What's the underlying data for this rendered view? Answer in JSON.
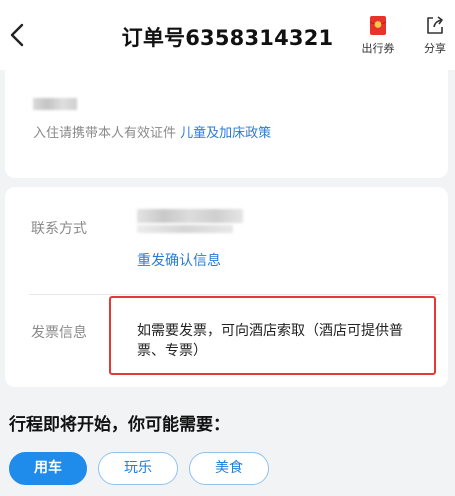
{
  "header": {
    "title": "订单号6358314321",
    "coupon_label": "出行券",
    "share_label": "分享"
  },
  "checkin": {
    "note": "入住请携带本人有效证件 ",
    "policy_link": "儿童及加床政策"
  },
  "contact": {
    "label": "联系方式",
    "resend_label": "重发确认信息"
  },
  "invoice": {
    "label": "发票信息",
    "text": "如需要发票，可向酒店索取（酒店可提供普票、专票）"
  },
  "trip": {
    "title": "行程即将开始，你可能需要：",
    "tabs": [
      {
        "label": "用车"
      },
      {
        "label": "玩乐"
      },
      {
        "label": "美食"
      }
    ]
  },
  "colors": {
    "accent": "#1f8ceb",
    "link": "#2b7bd6",
    "highlight_border": "#e53935"
  }
}
